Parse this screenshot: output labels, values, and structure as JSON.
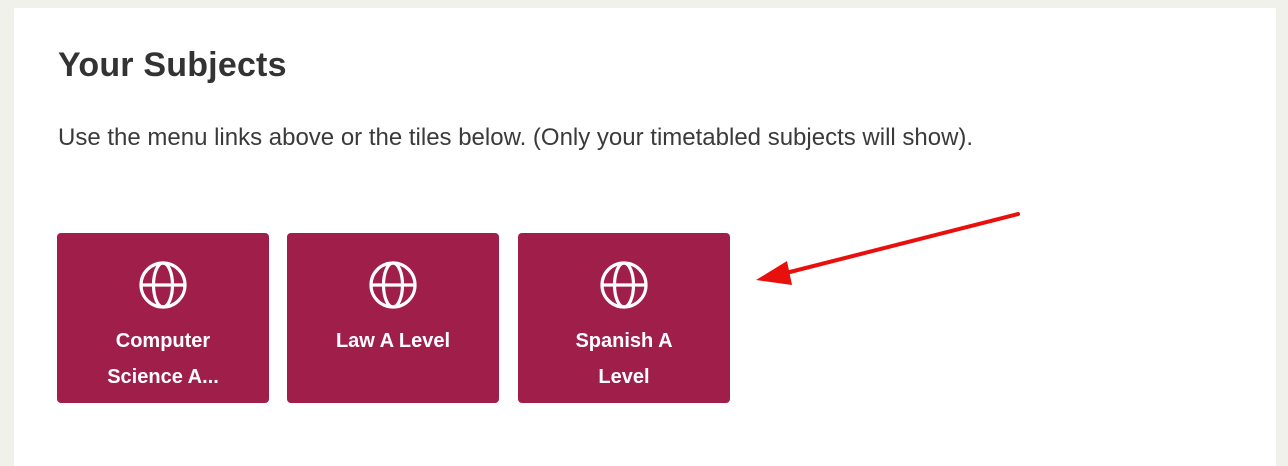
{
  "heading": "Your Subjects",
  "instructions": "Use the menu links above or the tiles below. (Only your timetabled subjects will show).",
  "tile_color": "#a01e4a",
  "annotation_color": "#e8100c",
  "tiles": [
    {
      "label": "Computer\nScience A...",
      "icon": "globe-icon"
    },
    {
      "label": "Law A Level",
      "icon": "globe-icon"
    },
    {
      "label": "Spanish A\nLevel",
      "icon": "globe-icon"
    }
  ]
}
